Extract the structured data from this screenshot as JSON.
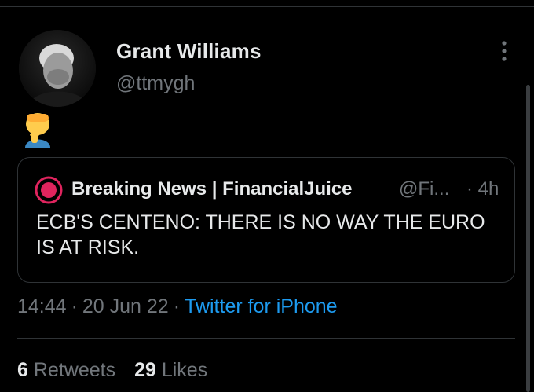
{
  "tweet": {
    "author_name": "Grant Williams",
    "author_handle": "@ttmygh",
    "emoji": "face-palm",
    "timestamp": "14:44",
    "separator": "·",
    "date": "20 Jun 22",
    "source": "Twitter for iPhone"
  },
  "quoted": {
    "name": "Breaking News | FinancialJuice",
    "handle": "@Fi...",
    "time": "· 4h",
    "text": "ECB'S CENTENO: THERE IS NO WAY THE EURO IS AT RISK."
  },
  "stats": {
    "retweets_count": "6",
    "retweets_label": "Retweets",
    "likes_count": "29",
    "likes_label": "Likes"
  },
  "colors": {
    "background": "#000000",
    "text_primary": "#e7e9ea",
    "text_secondary": "#71767b",
    "link": "#1d9bf0",
    "border": "#2f3336",
    "alert_red": "#e0245e"
  },
  "icons": {
    "more": "more-vertical-icon",
    "quote_avatar": "red-alert-icon"
  }
}
